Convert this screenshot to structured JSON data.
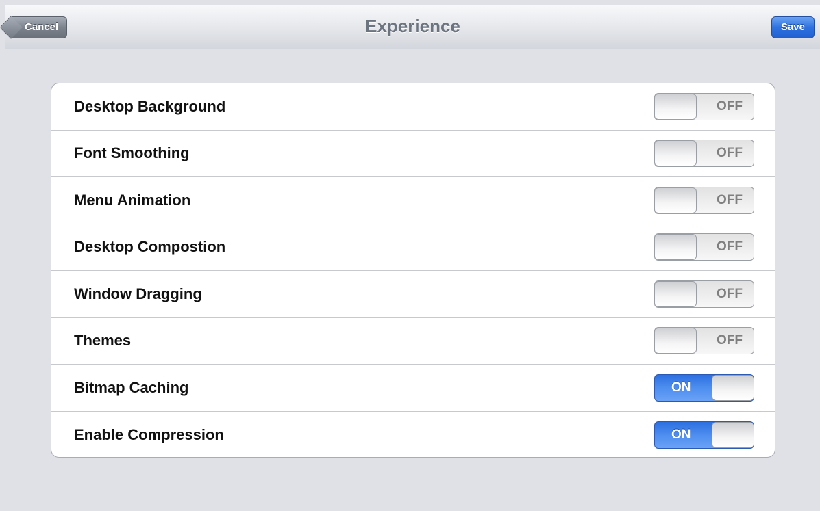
{
  "navbar": {
    "title": "Experience",
    "cancel_label": "Cancel",
    "save_label": "Save"
  },
  "settings": [
    {
      "label": "Desktop Background",
      "state": "OFF",
      "on": false
    },
    {
      "label": "Font Smoothing",
      "state": "OFF",
      "on": false
    },
    {
      "label": "Menu Animation",
      "state": "OFF",
      "on": false
    },
    {
      "label": "Desktop Compostion",
      "state": "OFF",
      "on": false
    },
    {
      "label": "Window Dragging",
      "state": "OFF",
      "on": false
    },
    {
      "label": "Themes",
      "state": "OFF",
      "on": false
    },
    {
      "label": "Bitmap Caching",
      "state": "ON",
      "on": true
    },
    {
      "label": "Enable Compression",
      "state": "ON",
      "on": true
    }
  ],
  "colors": {
    "accent": "#2f72e0",
    "background": "#dfe1e6"
  }
}
